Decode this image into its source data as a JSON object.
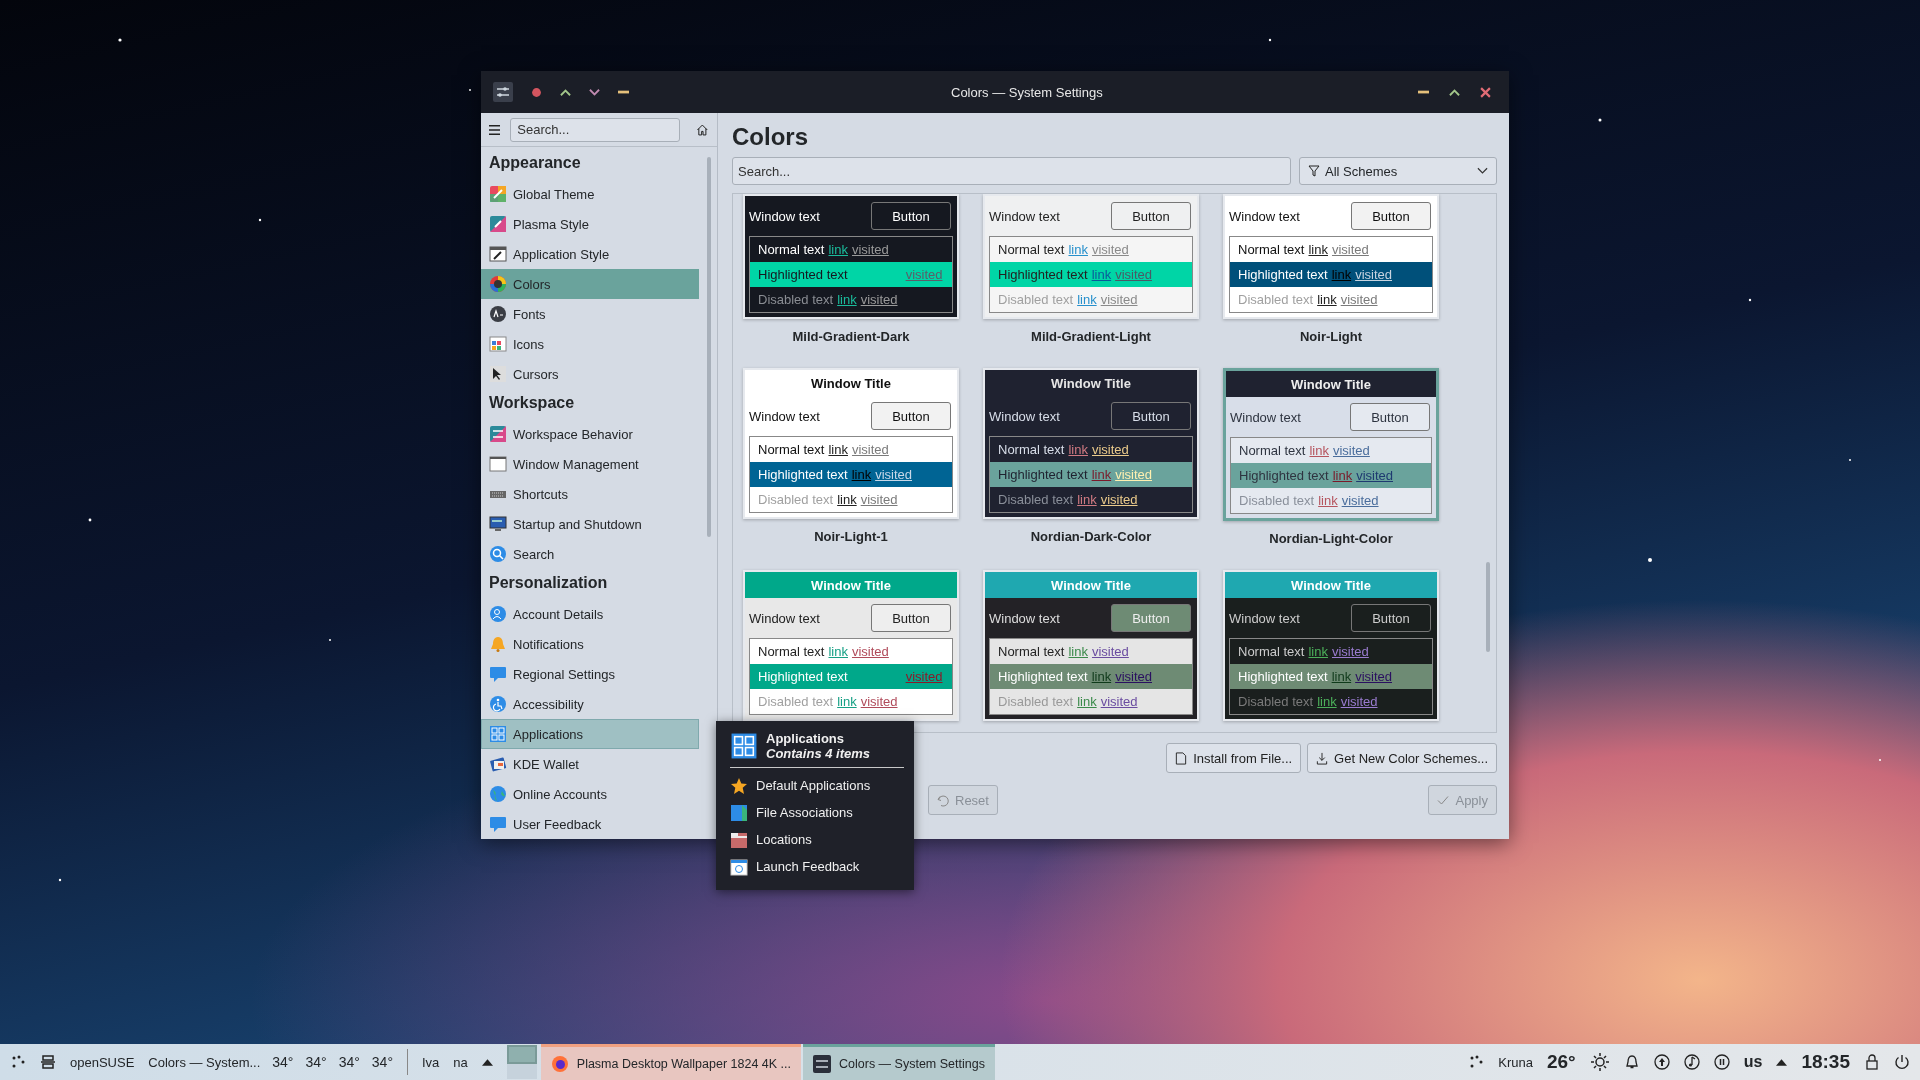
{
  "window": {
    "title": "Colors — System Settings"
  },
  "sidebar": {
    "search": {
      "placeholder": "Search..."
    },
    "sections": [
      {
        "title": "Appearance",
        "items": [
          {
            "label": "Global Theme",
            "selected": false,
            "hovered": false
          },
          {
            "label": "Plasma Style",
            "selected": false,
            "hovered": false
          },
          {
            "label": "Application Style",
            "selected": false,
            "hovered": false
          },
          {
            "label": "Colors",
            "selected": true,
            "hovered": false
          },
          {
            "label": "Fonts",
            "selected": false,
            "hovered": false
          },
          {
            "label": "Icons",
            "selected": false,
            "hovered": false
          },
          {
            "label": "Cursors",
            "selected": false,
            "hovered": false
          }
        ]
      },
      {
        "title": "Workspace",
        "items": [
          {
            "label": "Workspace Behavior",
            "selected": false,
            "hovered": false
          },
          {
            "label": "Window Management",
            "selected": false,
            "hovered": false
          },
          {
            "label": "Shortcuts",
            "selected": false,
            "hovered": false
          },
          {
            "label": "Startup and Shutdown",
            "selected": false,
            "hovered": false
          },
          {
            "label": "Search",
            "selected": false,
            "hovered": false
          }
        ]
      },
      {
        "title": "Personalization",
        "items": [
          {
            "label": "Account Details",
            "selected": false,
            "hovered": false
          },
          {
            "label": "Notifications",
            "selected": false,
            "hovered": false
          },
          {
            "label": "Regional Settings",
            "selected": false,
            "hovered": false
          },
          {
            "label": "Accessibility",
            "selected": false,
            "hovered": false
          },
          {
            "label": "Applications",
            "selected": false,
            "hovered": true
          },
          {
            "label": "KDE Wallet",
            "selected": false,
            "hovered": false
          },
          {
            "label": "Online Accounts",
            "selected": false,
            "hovered": false
          },
          {
            "label": "User Feedback",
            "selected": false,
            "hovered": false
          }
        ]
      }
    ]
  },
  "page": {
    "title": "Colors",
    "search": {
      "placeholder": "Search..."
    },
    "filter": {
      "value": "All Schemes"
    },
    "schemes": [
      {
        "name": "Mild-Gradient-Dark",
        "selected": false,
        "window_text": "Window text",
        "button": "Button",
        "rows": [
          {
            "kind": "normal",
            "text": "Normal text",
            "link": "link",
            "visited": "visited"
          },
          {
            "kind": "highlighted",
            "text": "Highlighted text",
            "visited": "visited"
          },
          {
            "kind": "disabled",
            "text": "Disabled text",
            "link": "link",
            "visited": "visited"
          }
        ]
      },
      {
        "name": "Mild-Gradient-Light",
        "selected": false,
        "window_text": "Window text",
        "button": "Button",
        "rows": [
          {
            "kind": "normal",
            "text": "Normal text",
            "link": "link",
            "visited": "visited"
          },
          {
            "kind": "highlighted",
            "text": "Highlighted text",
            "link": "link",
            "visited": "visited"
          },
          {
            "kind": "disabled",
            "text": "Disabled text",
            "link": "link",
            "visited": "visited"
          }
        ]
      },
      {
        "name": "Noir-Light",
        "selected": false,
        "window_text": "Window text",
        "button": "Button",
        "rows": [
          {
            "kind": "normal",
            "text": "Normal text",
            "link": "link",
            "visited": "visited"
          },
          {
            "kind": "highlighted",
            "text": "Highlighted text",
            "link": "link",
            "visited": "visited"
          },
          {
            "kind": "disabled",
            "text": "Disabled text",
            "link": "link",
            "visited": "visited"
          }
        ]
      },
      {
        "name": "Noir-Light-1",
        "selected": false,
        "title": "Window Title",
        "window_text": "Window text",
        "button": "Button",
        "rows": [
          {
            "kind": "normal",
            "text": "Normal text",
            "link": "link",
            "visited": "visited"
          },
          {
            "kind": "highlighted",
            "text": "Highlighted text",
            "link": "link",
            "visited": "visited"
          },
          {
            "kind": "disabled",
            "text": "Disabled text",
            "link": "link",
            "visited": "visited"
          }
        ]
      },
      {
        "name": "Nordian-Dark-Color",
        "selected": false,
        "title": "Window Title",
        "window_text": "Window text",
        "button": "Button",
        "rows": [
          {
            "kind": "normal",
            "text": "Normal text",
            "link": "link",
            "visited": "visited"
          },
          {
            "kind": "highlighted",
            "text": "Highlighted text",
            "link": "link",
            "visited": "visited"
          },
          {
            "kind": "disabled",
            "text": "Disabled text",
            "link": "link",
            "visited": "visited"
          }
        ]
      },
      {
        "name": "Nordian-Light-Color",
        "selected": true,
        "title": "Window Title",
        "window_text": "Window text",
        "button": "Button",
        "rows": [
          {
            "kind": "normal",
            "text": "Normal text",
            "link": "link",
            "visited": "visited"
          },
          {
            "kind": "highlighted",
            "text": "Highlighted text",
            "link": "link",
            "visited": "visited"
          },
          {
            "kind": "disabled",
            "text": "Disabled text",
            "link": "link",
            "visited": "visited"
          }
        ]
      },
      {
        "selected": false,
        "title": "Window Title",
        "window_text": "Window text",
        "button": "Button",
        "rows": [
          {
            "kind": "normal",
            "text": "Normal text",
            "link": "link",
            "visited": "visited"
          },
          {
            "kind": "highlighted",
            "text": "Highlighted text",
            "visited": "visited"
          },
          {
            "kind": "disabled",
            "text": "Disabled text",
            "link": "link",
            "visited": "visited"
          }
        ]
      },
      {
        "selected": false,
        "title": "Window Title",
        "window_text": "Window text",
        "button": "Button",
        "rows": [
          {
            "kind": "normal",
            "text": "Normal text",
            "link": "link",
            "visited": "visited"
          },
          {
            "kind": "highlighted",
            "text": "Highlighted text",
            "link": "link",
            "visited": "visited"
          },
          {
            "kind": "disabled",
            "text": "Disabled text",
            "link": "link",
            "visited": "visited"
          }
        ]
      },
      {
        "selected": false,
        "title": "Window Title",
        "window_text": "Window text",
        "button": "Button",
        "rows": [
          {
            "kind": "normal",
            "text": "Normal text",
            "link": "link",
            "visited": "visited"
          },
          {
            "kind": "highlighted",
            "text": "Highlighted text",
            "link": "link",
            "visited": "visited"
          },
          {
            "kind": "disabled",
            "text": "Disabled text",
            "link": "link",
            "visited": "visited"
          }
        ]
      }
    ],
    "actions": [
      {
        "label": "Install from File..."
      },
      {
        "label": "Get New Color Schemes..."
      }
    ],
    "footer": {
      "reset": {
        "label": "Reset",
        "disabled": true
      },
      "apply": {
        "label": "Apply",
        "disabled": true
      }
    }
  },
  "popup": {
    "title": "Applications",
    "subtitle": "Contains 4 items",
    "items": [
      "Default Applications",
      "File Associations",
      "Locations",
      "Launch Feedback"
    ]
  },
  "taskbar": {
    "left_texts": [
      "openSUSE",
      "Colors — System..."
    ],
    "temperatures": [
      "34°",
      "34°",
      "34°",
      "34°"
    ],
    "labels": [
      "Iva",
      "na"
    ],
    "tasks": [
      {
        "label": "Plasma Desktop Wallpaper 1824 4K ...",
        "active": false
      },
      {
        "label": "Colors — System Settings",
        "active": true
      }
    ],
    "user": "Kruna",
    "weather": "26°",
    "keyboard": "us",
    "clock": "18:35"
  }
}
